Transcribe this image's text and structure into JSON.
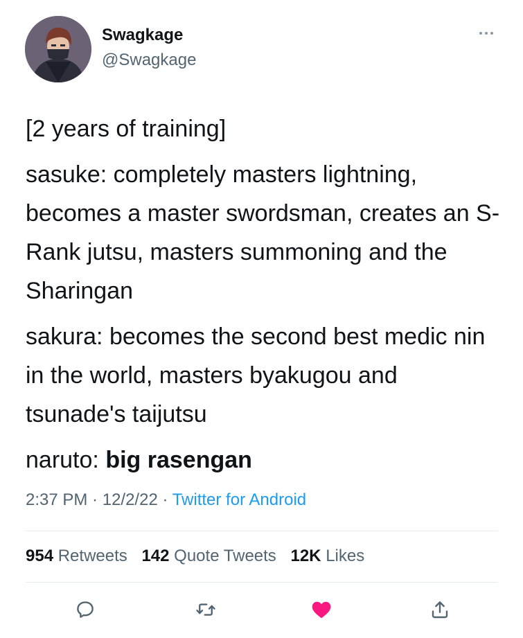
{
  "user": {
    "display_name": "Swagkage",
    "handle": "@Swagkage",
    "avatar_icon": "anime-character-avatar"
  },
  "tweet": {
    "line1": "[2 years of training]",
    "line2": "sasuke: completely masters lightning, becomes a master swordsman, creates an S-Rank jutsu, masters summoning and the Sharingan",
    "line3": "sakura: becomes the second best medic nin in the world, masters byakugou and tsunade's taijutsu",
    "line4_prefix": "naruto: ",
    "line4_bold": "big rasengan"
  },
  "meta": {
    "time": "2:37 PM",
    "separator": " · ",
    "date": "12/2/22",
    "source": "Twitter for Android"
  },
  "stats": {
    "retweets_count": "954",
    "retweets_label": "Retweets",
    "quote_count": "142",
    "quote_label": "Quote Tweets",
    "likes_count": "12K",
    "likes_label": "Likes"
  },
  "actions": {
    "reply_icon": "reply-icon",
    "retweet_icon": "retweet-icon",
    "like_icon": "heart-icon",
    "share_icon": "share-icon",
    "like_color": "#f91880"
  },
  "colors": {
    "text": "#0f1419",
    "secondary": "#536471",
    "link": "#1d9bf0"
  }
}
